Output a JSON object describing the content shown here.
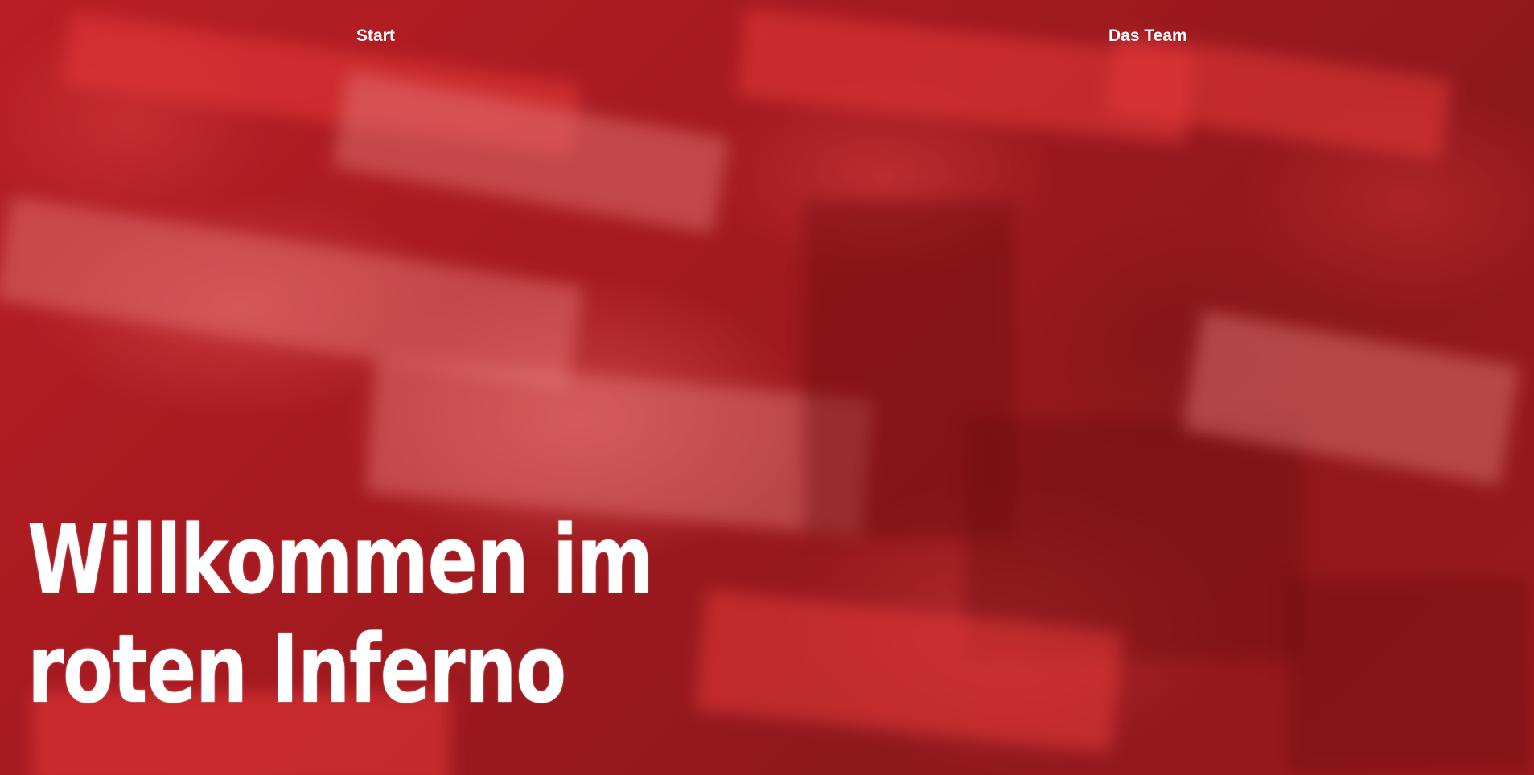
{
  "nav": {
    "items": [
      {
        "label": "Start"
      },
      {
        "label": "Das Team"
      }
    ]
  },
  "hero": {
    "title": "Willkommen im roten Inferno"
  },
  "colors": {
    "background": "#8e1a1c",
    "accent": "#c4232a",
    "text": "#ffffff"
  }
}
